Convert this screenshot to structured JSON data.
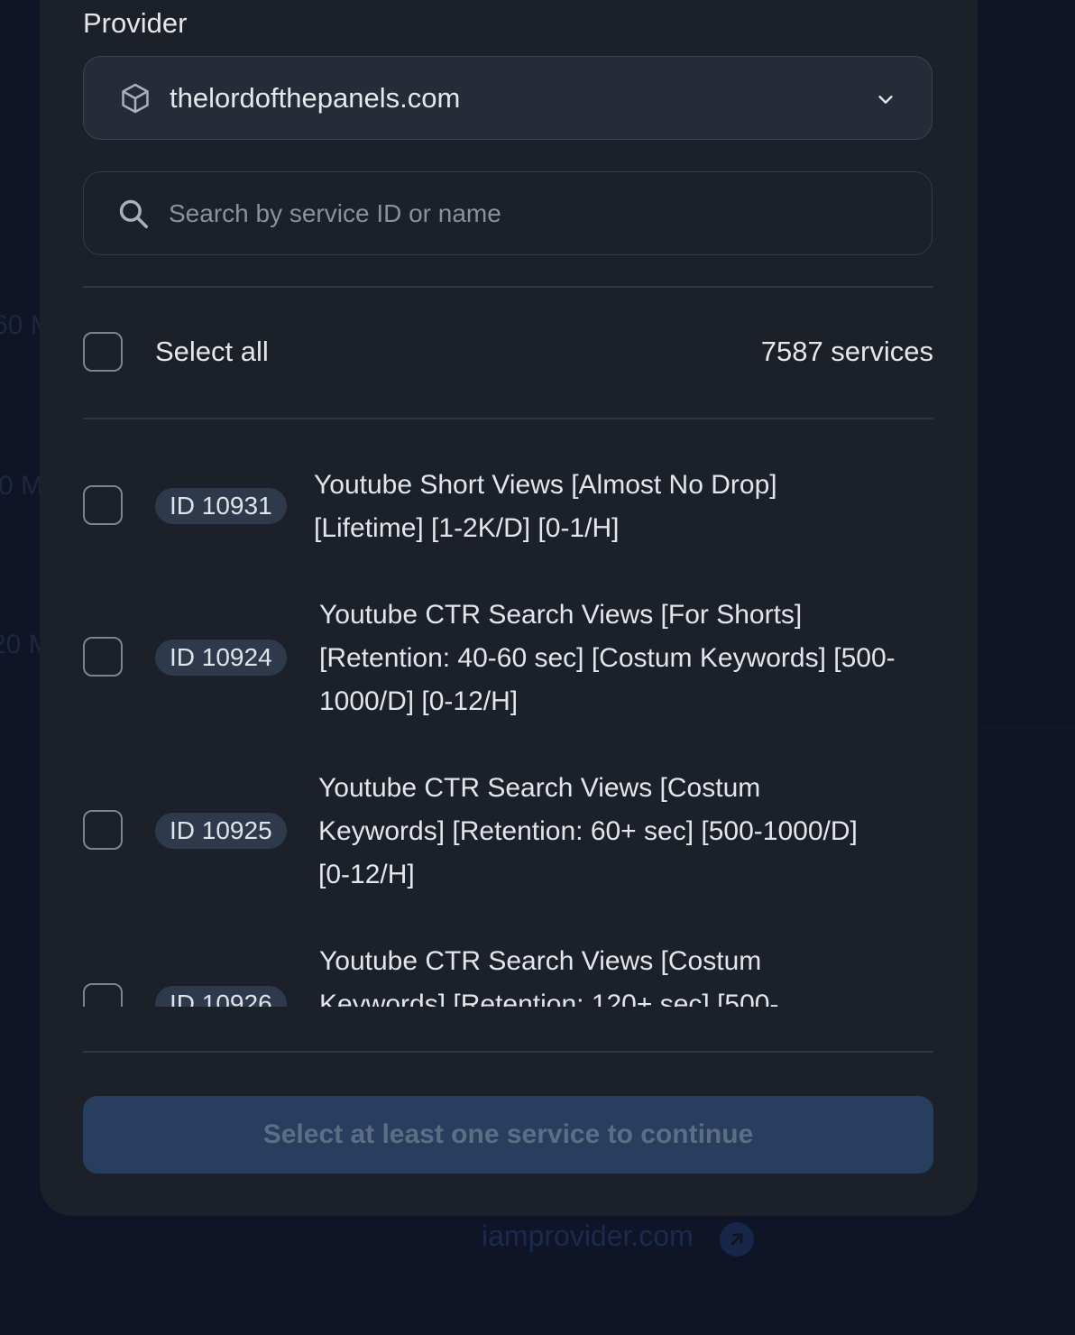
{
  "background": {
    "fragments": [
      "60 M",
      "0 M",
      "20 M"
    ],
    "footer_link": "iamprovider.com"
  },
  "provider": {
    "label": "Provider",
    "selected": "thelordofthepanels.com"
  },
  "search": {
    "placeholder": "Search by service ID or name"
  },
  "select_all": {
    "label": "Select all",
    "count": "7587 services"
  },
  "services": [
    {
      "id": "ID 10931",
      "name": "Youtube Short Views [Almost No Drop] [Lifetime] [1-2K/D] [0-1/H]"
    },
    {
      "id": "ID 10924",
      "name": "Youtube CTR Search Views [For Shorts] [Retention: 40-60 sec] [Costum Keywords] [500-1000/D] [0-12/H]"
    },
    {
      "id": "ID 10925",
      "name": "Youtube CTR Search Views [Costum Keywords] [Retention: 60+ sec] [500-1000/D] [0-12/H]"
    },
    {
      "id": "ID 10926",
      "name": "Youtube CTR Search Views [Costum Keywords] [Retention: 120+ sec] [500-"
    }
  ],
  "continue_button": {
    "label": "Select at least one service to continue"
  },
  "colors": {
    "page_background": "#0f1426",
    "modal_background": "#1c2028",
    "badge_background": "#2e3a4b",
    "button_disabled": "#283e5e"
  }
}
